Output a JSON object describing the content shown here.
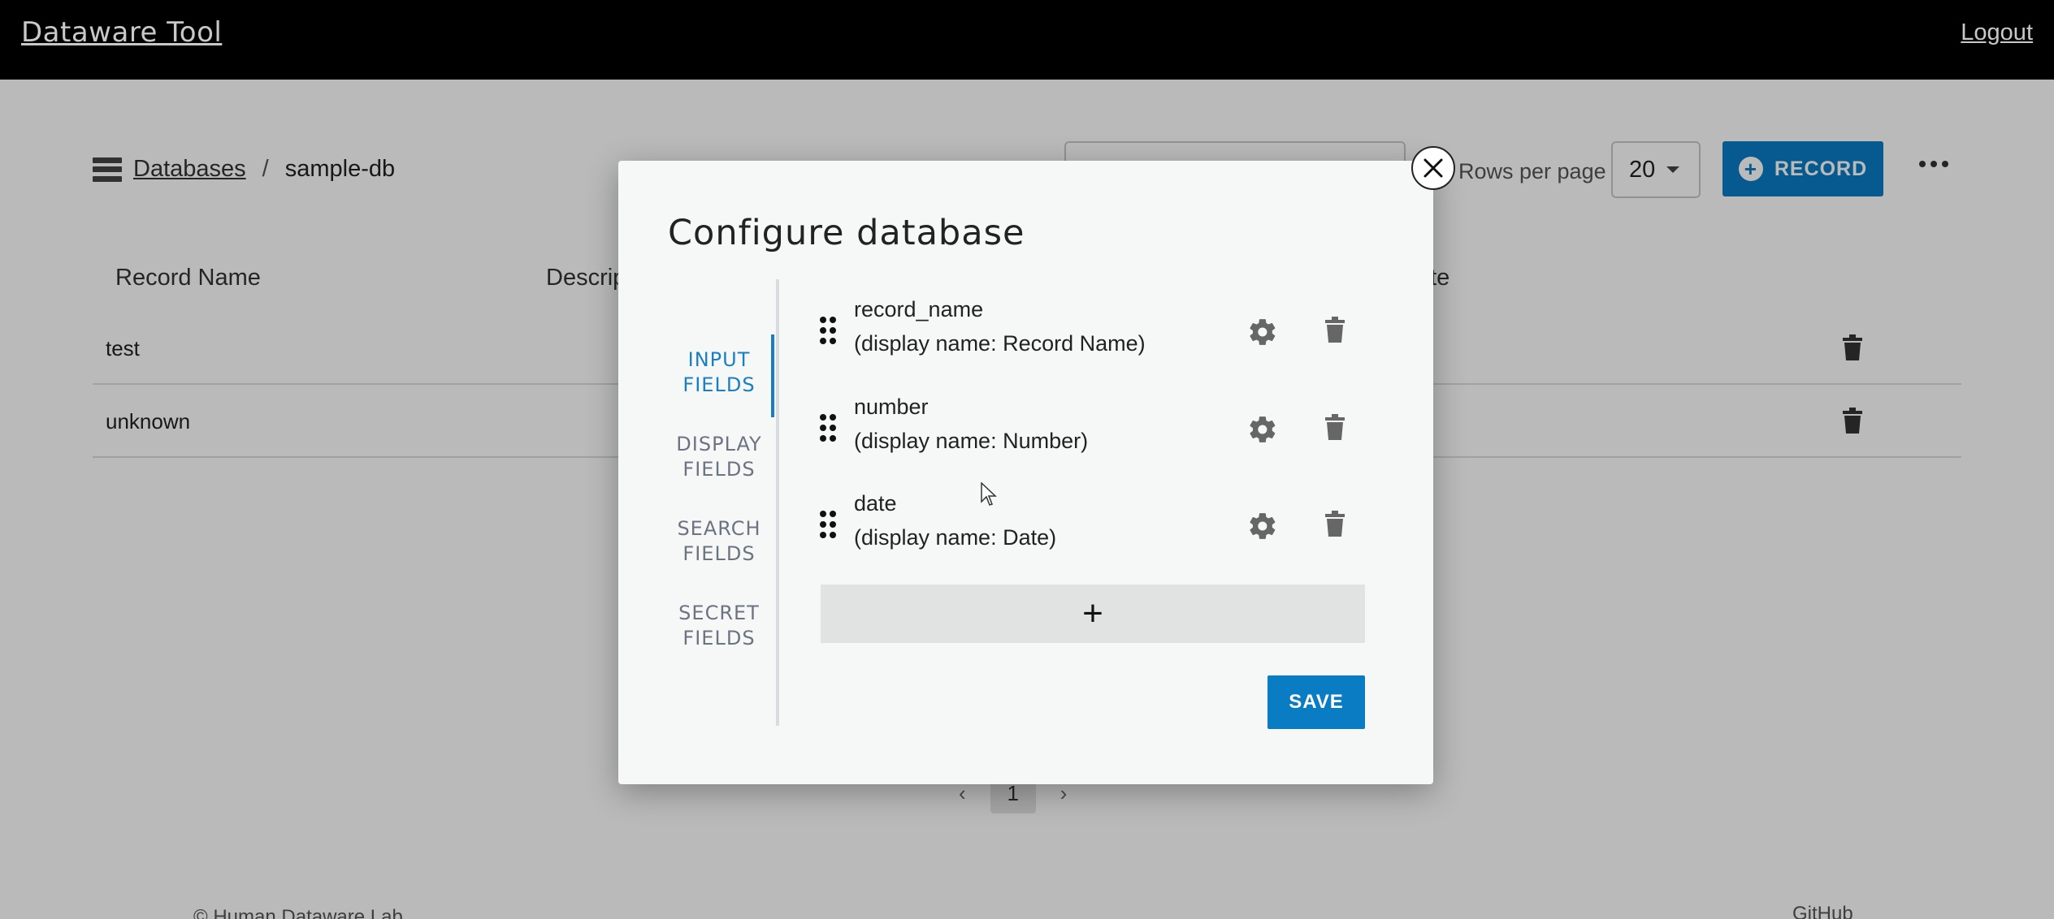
{
  "topbar": {
    "brand": "Dataware Tool",
    "logout": "Logout"
  },
  "breadcrumb": {
    "databases": "Databases",
    "separator": "/",
    "current": "sample-db"
  },
  "toolbar": {
    "rows_per_page_label": "Rows per page",
    "rows_per_page_value": "20",
    "record_button": "RECORD"
  },
  "table": {
    "headers": [
      "Record Name",
      "Descrip",
      "ate"
    ],
    "rows": [
      {
        "name": "test"
      },
      {
        "name": "unknown"
      }
    ]
  },
  "pagination": {
    "current_page": "1",
    "prev": "‹",
    "next": "›"
  },
  "footer": {
    "left": "© Human Dataware Lab",
    "right": "GitHub"
  },
  "modal": {
    "title": "Configure database",
    "close_symbol": "×",
    "tabs": [
      {
        "line1": "INPUT",
        "line2": "FIELDS",
        "active": true
      },
      {
        "line1": "DISPLAY",
        "line2": "FIELDS",
        "active": false
      },
      {
        "line1": "SEARCH",
        "line2": "FIELDS",
        "active": false
      },
      {
        "line1": "SECRET",
        "line2": "FIELDS",
        "active": false
      }
    ],
    "fields": [
      {
        "name": "record_name",
        "display": "(display name: Record Name)"
      },
      {
        "name": "number",
        "display": "(display name: Number)"
      },
      {
        "name": "date",
        "display": "(display name: Date)"
      }
    ],
    "add_symbol": "+",
    "save_label": "SAVE"
  },
  "colors": {
    "primary": "#0a7cc4",
    "tab_active": "#1a7fc1",
    "topbar": "#000000"
  },
  "icons": [
    "database-icon",
    "plus-circle-icon",
    "more-icon",
    "trash-icon",
    "gear-icon",
    "drag-handle-icon",
    "close-icon"
  ]
}
